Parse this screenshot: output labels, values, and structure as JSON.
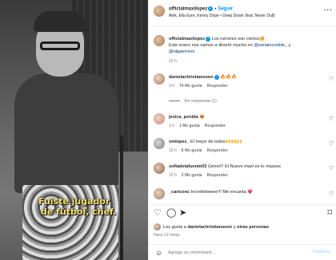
{
  "media": {
    "caption_line1": "Fuiste jugador",
    "caption_line2": "de fútbol, chef."
  },
  "header": {
    "username": "officialmaxilopez",
    "separator": "•",
    "follow_label": "Seguir",
    "song": "Alok, Ella Eyre, Kenny Dope • Deep Down (feat. Never Dull)",
    "more_icon": "more-icon"
  },
  "caption": {
    "username": "officialmaxilopez",
    "text1": " Los rumores son ciertos🥳",
    "text2": "Este enero nos vamos a divertir mucho en ",
    "mention1": "@seriaincreible_",
    "text3": " y",
    "mention2": "@olgaenvivo",
    "time": "12 h"
  },
  "comments": [
    {
      "username": "danielachristiansson",
      "verified": true,
      "text": " 🔥🔥🔥",
      "time": "3 h",
      "likes": "74 Me gusta",
      "reply": "Responder"
    },
    {
      "username": "jesica_penida",
      "verified": false,
      "text": " 😻",
      "time": "1 h",
      "likes": "1 Me gusta",
      "reply": "Responder"
    },
    {
      "username": "vmlopez_",
      "verified": false,
      "text": " El mejor de todos🙌🙌🙌",
      "time": "12 h",
      "likes": "6 Me gusta",
      "reply": "Responder"
    },
    {
      "username": "sofiadelafuente03",
      "verified": false,
      "text": " Genio!!! El Nuevo maxi es lo massss",
      "time": "12 h",
      "likes": "2 Me gusta",
      "reply": "Responder"
    },
    {
      "username": "_cariconc",
      "verified": false,
      "text": " Increibleeeee!!! Me encanta 💗",
      "time": "11 h",
      "likes": "",
      "reply": ""
    }
  ],
  "replies_label": "Ver respuestas (1)",
  "actions": {
    "like_icon": "heart-icon",
    "comment_icon": "comment-icon",
    "share_icon": "share-icon",
    "save_icon": "bookmark-icon"
  },
  "likes_line": {
    "prefix": "Les gusta a ",
    "user": "danielachristiansson",
    "mid": " y ",
    "others": "otras personas"
  },
  "posted_ago": "Hace 12 horas",
  "add_comment": {
    "emoji_icon": "emoji-icon",
    "placeholder": "Agrega un comentario...",
    "publish_label": "Publicar"
  }
}
